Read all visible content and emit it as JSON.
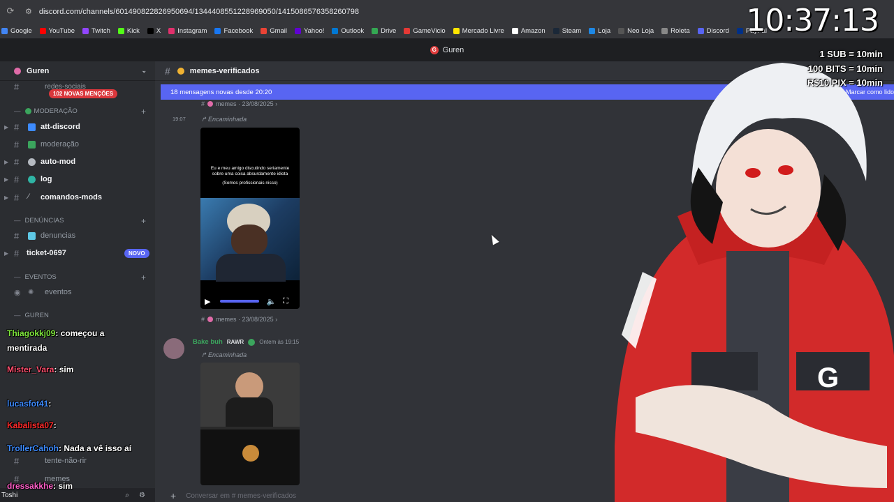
{
  "browser": {
    "url": "discord.com/channels/601490822826950694/1344408551228969050/1415086576358260798",
    "bookmarks": [
      {
        "label": "Google",
        "color": "#4285f4",
        "icon": "google-icon"
      },
      {
        "label": "YouTube",
        "color": "#ff0000",
        "icon": "youtube-icon"
      },
      {
        "label": "Twitch",
        "color": "#9146ff",
        "icon": "twitch-icon"
      },
      {
        "label": "Kick",
        "color": "#53fc18",
        "icon": "kick-icon"
      },
      {
        "label": "X",
        "color": "#000000",
        "icon": "x-icon"
      },
      {
        "label": "Instagram",
        "color": "#e1306c",
        "icon": "instagram-icon"
      },
      {
        "label": "Facebook",
        "color": "#1877f2",
        "icon": "facebook-icon"
      },
      {
        "label": "Gmail",
        "color": "#ea4335",
        "icon": "gmail-icon"
      },
      {
        "label": "Yahoo!",
        "color": "#6001d2",
        "icon": "yahoo-icon"
      },
      {
        "label": "Outlook",
        "color": "#0078d4",
        "icon": "outlook-icon"
      },
      {
        "label": "Drive",
        "color": "#34a853",
        "icon": "drive-icon"
      },
      {
        "label": "GameVicio",
        "color": "#e53935",
        "icon": "gamevicio-icon"
      },
      {
        "label": "Mercado Livre",
        "color": "#ffe600",
        "icon": "mercadolivre-icon"
      },
      {
        "label": "Amazon",
        "color": "#ffffff",
        "icon": "amazon-icon"
      },
      {
        "label": "Steam",
        "color": "#1b2838",
        "icon": "steam-icon"
      },
      {
        "label": "Loja",
        "color": "#1e88e5",
        "icon": "store-icon"
      },
      {
        "label": "Neo Loja",
        "color": "#555555",
        "icon": "store-icon"
      },
      {
        "label": "Roleta",
        "color": "#888888",
        "icon": "roulette-icon"
      },
      {
        "label": "Discord",
        "color": "#5865f2",
        "icon": "discord-icon"
      },
      {
        "label": "PayPal",
        "color": "#003087",
        "icon": "paypal-icon"
      }
    ]
  },
  "window_title": "Guren",
  "sidebar": {
    "server_name": "Guren",
    "mentions_badge": "102 NOVAS MENÇÕES",
    "mentions_color": "#da373c",
    "truncated_top": "redes-sociais",
    "categories": {
      "moderacao": "MODERAÇÃO",
      "denuncias": "DENÚNCIAS",
      "eventos": "EVENTOS",
      "guren": "GUREN"
    },
    "channels": {
      "att_discord": "att-discord",
      "moderacao": "moderação",
      "auto_mod": "auto-mod",
      "log": "log",
      "comandos_mods": "comandos-mods",
      "denuncias": "denuncias",
      "ticket": "ticket-0697",
      "eventos": "eventos",
      "tente": "tente-não-rir",
      "memes": "memes"
    },
    "novo_badge": "NOVO",
    "novo_color": "#5865f2",
    "user": "Toshi"
  },
  "chat": {
    "channel": "memes-verificados",
    "new_messages": "18 mensagens novas desde 20:20",
    "mark_read": "Marcar como lido",
    "msg1": {
      "source": "memes",
      "date": "23/08/2025",
      "time": "19:07",
      "forwarded": "Encaminhada",
      "caption": "Eu e meu amigo discutindo seriamente sobre uma coisa absurdamente idiota",
      "caption2": "(Somos profissionais nisso)"
    },
    "msg1_footer": {
      "source": "memes",
      "date": "23/08/2025"
    },
    "msg2": {
      "author": "Bake buh",
      "tag": "RAWR",
      "timestamp": "Ontem às 19:15",
      "forwarded": "Encaminhada"
    },
    "input_placeholder": "Conversar em # memes-verificados"
  },
  "stream_overlay": {
    "clock": "10:37:13",
    "goals": [
      "1 SUB = 10min",
      "100 BITS = 10min",
      "R$10 PIX = 10min"
    ],
    "chat": [
      {
        "user": "Thiagokkj09",
        "color": "#7ee63c",
        "msg": ": começou a mentirada"
      },
      {
        "user": "Mister_Vara",
        "color": "#ff4d6d",
        "msg": ": sim"
      },
      {
        "user": "lucasfot41",
        "color": "#3d8bff",
        "msg": ":"
      },
      {
        "user": "Kabalista07",
        "color": "#ff2a2a",
        "msg": ":"
      },
      {
        "user": "TrollerCahoh",
        "color": "#3d8bff",
        "msg": ": Nada a vê isso aí"
      },
      {
        "user": "dressakkhe",
        "color": "#ff5ec8",
        "msg": ": sim"
      }
    ]
  }
}
